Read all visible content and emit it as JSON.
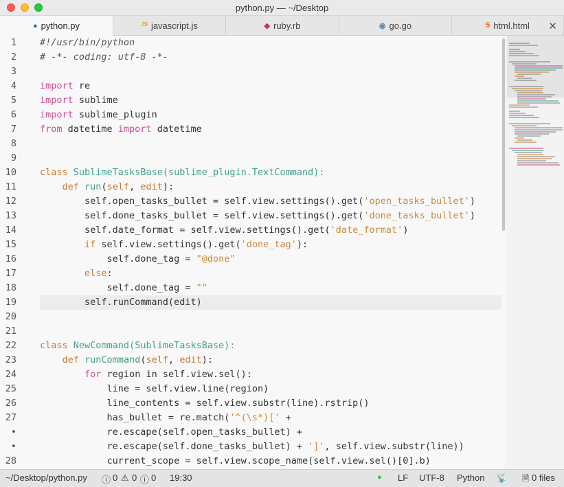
{
  "window": {
    "title": "python.py — ~/Desktop"
  },
  "tabs": [
    {
      "label": "python.py",
      "icon": "python-icon",
      "active": true
    },
    {
      "label": "javascript.js",
      "icon": "js-icon",
      "active": false
    },
    {
      "label": "ruby.rb",
      "icon": "ruby-icon",
      "active": false
    },
    {
      "label": "go.go",
      "icon": "go-icon",
      "active": false
    },
    {
      "label": "html.html",
      "icon": "html-icon",
      "active": false
    }
  ],
  "tab_close": "✕",
  "gutter": [
    "1",
    "2",
    "3",
    "4",
    "5",
    "6",
    "7",
    "8",
    "9",
    "10",
    "11",
    "12",
    "13",
    "14",
    "15",
    "16",
    "17",
    "18",
    "19",
    "20",
    "21",
    "22",
    "23",
    "24",
    "25",
    "26",
    "27",
    "•",
    "•",
    "28"
  ],
  "code": [
    [
      [
        "cm",
        "#!/usr/bin/python"
      ]
    ],
    [
      [
        "cm",
        "# -*- coding: utf-8 -*-"
      ]
    ],
    [],
    [
      [
        "kw2",
        "import"
      ],
      [
        "",
        " re"
      ]
    ],
    [
      [
        "kw2",
        "import"
      ],
      [
        "",
        " sublime"
      ]
    ],
    [
      [
        "kw2",
        "import"
      ],
      [
        "",
        " sublime_plugin"
      ]
    ],
    [
      [
        "kw2",
        "from"
      ],
      [
        "",
        " datetime "
      ],
      [
        "kw2",
        "import"
      ],
      [
        "",
        " datetime"
      ]
    ],
    [],
    [],
    [
      [
        "k",
        "class"
      ],
      [
        "",
        " "
      ],
      [
        "cls",
        "SublimeTasksBase"
      ],
      [
        "cls",
        "("
      ],
      [
        "cls",
        "sublime_plugin.TextCommand"
      ],
      [
        "cls",
        "):"
      ]
    ],
    [
      [
        "",
        "    "
      ],
      [
        "k",
        "def"
      ],
      [
        "",
        " "
      ],
      [
        "fn",
        "run"
      ],
      [
        "",
        "("
      ],
      [
        "prm",
        "self"
      ],
      [
        "",
        ", "
      ],
      [
        "prm",
        "edit"
      ],
      [
        "",
        "):"
      ]
    ],
    [
      [
        "",
        "        self.open_tasks_bullet = self.view.settings().get("
      ],
      [
        "str",
        "'open_tasks_bullet'"
      ],
      [
        "",
        ")"
      ]
    ],
    [
      [
        "",
        "        self.done_tasks_bullet = self.view.settings().get("
      ],
      [
        "str",
        "'done_tasks_bullet'"
      ],
      [
        "",
        ")"
      ]
    ],
    [
      [
        "",
        "        self.date_format = self.view.settings().get("
      ],
      [
        "str",
        "'date_format'"
      ],
      [
        "",
        ")"
      ]
    ],
    [
      [
        "",
        "        "
      ],
      [
        "k",
        "if"
      ],
      [
        "",
        " self.view.settings().get("
      ],
      [
        "str",
        "'done_tag'"
      ],
      [
        "",
        "):"
      ]
    ],
    [
      [
        "",
        "            self.done_tag = "
      ],
      [
        "str",
        "\"@done\""
      ]
    ],
    [
      [
        "",
        "        "
      ],
      [
        "k",
        "else"
      ],
      [
        "",
        ":"
      ]
    ],
    [
      [
        "",
        "            self.done_tag = "
      ],
      [
        "str",
        "\"\""
      ]
    ],
    [
      [
        "",
        "        self.runCommand(edit)"
      ]
    ],
    [],
    [],
    [
      [
        "k",
        "class"
      ],
      [
        "",
        " "
      ],
      [
        "cls",
        "NewCommand"
      ],
      [
        "cls",
        "(SublimeTasksBase):"
      ]
    ],
    [
      [
        "",
        "    "
      ],
      [
        "k",
        "def"
      ],
      [
        "",
        " "
      ],
      [
        "fn",
        "runCommand"
      ],
      [
        "",
        "("
      ],
      [
        "prm",
        "self"
      ],
      [
        "",
        ", "
      ],
      [
        "prm",
        "edit"
      ],
      [
        "",
        "):"
      ]
    ],
    [
      [
        "",
        "        "
      ],
      [
        "kw2",
        "for"
      ],
      [
        "",
        " region in self.view.sel():"
      ]
    ],
    [
      [
        "",
        "            line = self.view.line(region)"
      ]
    ],
    [
      [
        "",
        "            line_contents = self.view.substr(line).rstrip()"
      ]
    ],
    [
      [
        "",
        "            has_bullet = re.match("
      ],
      [
        "str",
        "'^(\\s*)['"
      ],
      [
        "",
        " +"
      ]
    ],
    [
      [
        "",
        "            re.escape(self.open_tasks_bullet) +"
      ]
    ],
    [
      [
        "",
        "            re.escape(self.done_tasks_bullet) + "
      ],
      [
        "str",
        "']'"
      ],
      [
        "",
        ", self.view.substr(line))"
      ]
    ],
    [
      [
        "",
        "            current_scope = self.view.scope_name(self.view.sel()[0].b)"
      ]
    ]
  ],
  "highlight_line": 19,
  "status": {
    "path": "~/Desktop/python.py",
    "errors": "0",
    "warnings": "0",
    "info": "0",
    "position": "19:30",
    "line_ending": "LF",
    "encoding": "UTF-8",
    "syntax": "Python",
    "files": "0 files"
  },
  "colors": {
    "keyword": "#c97a2f",
    "class": "#3f9f8a",
    "string": "#c98a3a",
    "import": "#c94f94",
    "comment": "#555555"
  }
}
